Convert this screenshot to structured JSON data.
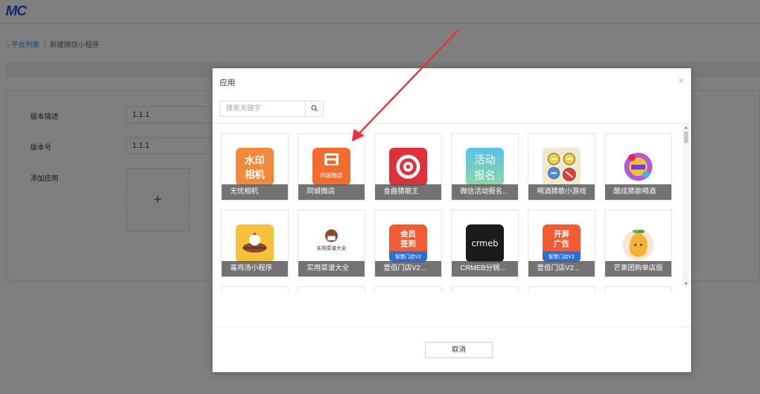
{
  "app": {
    "logo": "MC"
  },
  "breadcrumb": {
    "back": "平台列表",
    "separator": "/",
    "current": "新建微信小程序"
  },
  "form": {
    "desc_label": "版本描述",
    "desc_value": "1.1.1",
    "ver_label": "版本号",
    "ver_value": "1.1.1",
    "apps_label": "添加应用",
    "add_glyph": "+"
  },
  "modal": {
    "title": "应用",
    "close": "×",
    "search_placeholder": "搜索关键字",
    "cancel_label": "取消",
    "items": [
      {
        "label": "无忧相机",
        "icon": "watermark-camera-icon",
        "icon_text": [
          "水印",
          "相机"
        ]
      },
      {
        "label": "同城微店",
        "icon": "storefront-icon",
        "icon_text": [
          "同城微店"
        ]
      },
      {
        "label": "金曲猜歌王",
        "icon": "target-ring-icon"
      },
      {
        "label": "微信活动报名...",
        "icon": "activity-signup-icon",
        "icon_text": [
          "活动",
          "报名"
        ]
      },
      {
        "label": "喝酒猜歌小游戏",
        "icon": "arrows-game-icon"
      },
      {
        "label": "酷炫猜歌喝酒",
        "icon": "party-emblem-icon"
      },
      {
        "label": "毒鸡汤小程序",
        "icon": "chicken-soup-icon"
      },
      {
        "label": "实用菜谱大全",
        "icon": "chef-hat-icon",
        "icon_text": [
          "实用菜谱大全"
        ]
      },
      {
        "label": "壹佰门店V2...",
        "icon": "member-store-icon",
        "icon_text": [
          "会员",
          "签到",
          "智慧门店V2"
        ]
      },
      {
        "label": "CRMEB分销...",
        "icon": "crmeb-logo-icon",
        "icon_text": [
          "crmeb"
        ]
      },
      {
        "label": "壹佰门店V2...",
        "icon": "open-store-icon",
        "icon_text": [
          "开屏",
          "广告",
          "智慧门店V2"
        ]
      },
      {
        "label": "芒果团购单店版",
        "icon": "mango-icon"
      }
    ]
  },
  "colors": {
    "accent": "#1e88e5",
    "overlay": "rgba(0,0,0,0.5)",
    "arrow": "#e8333a"
  }
}
